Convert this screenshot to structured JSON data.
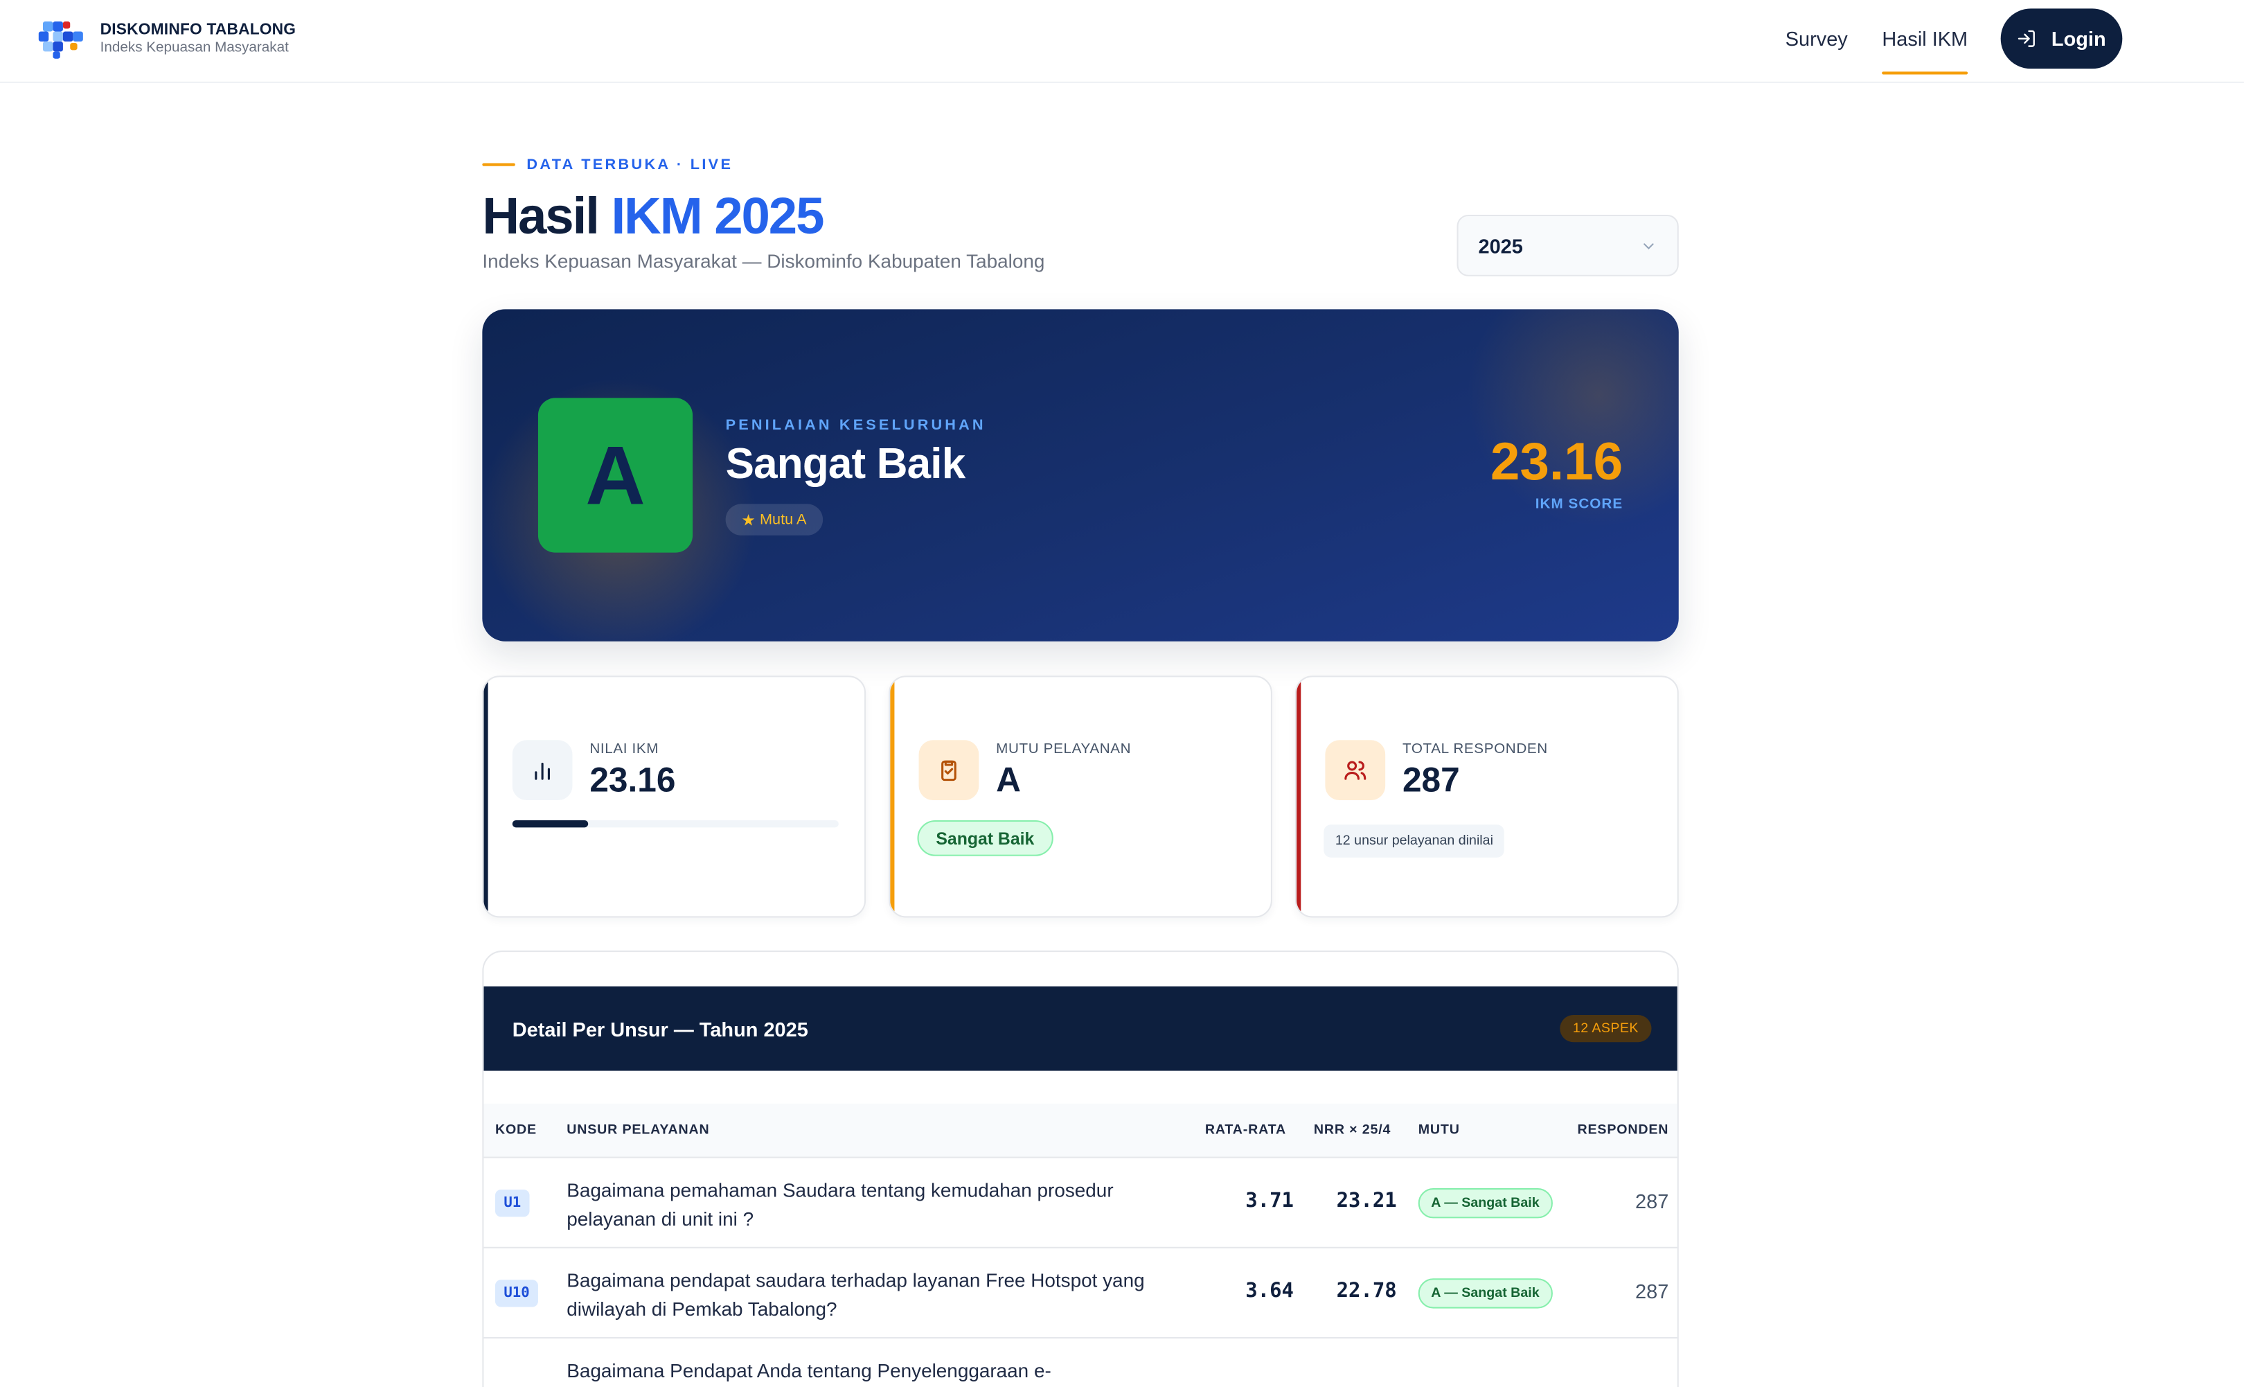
{
  "header": {
    "brand_name": "DISKOMINFO TABALONG",
    "brand_sub": "Indeks Kepuasan Masyarakat",
    "nav": [
      "Survey",
      "Hasil IKM"
    ],
    "login_label": "Login"
  },
  "page": {
    "eyebrow": "DATA TERBUKA · LIVE",
    "title_prefix": "Hasil",
    "title_accent": "IKM 2025",
    "subtitle": "Indeks Kepuasan Masyarakat — Diskominfo Kabupaten Tabalong",
    "year_selected": "2025"
  },
  "hero": {
    "grade": "A",
    "eyebrow": "PENILAIAN KESELURUHAN",
    "title": "Sangat Baik",
    "badge": "Mutu A",
    "score": "23.16",
    "score_label": "IKM SCORE"
  },
  "stats": {
    "nilai": {
      "label": "NILAI IKM",
      "value": "23.16",
      "progress_fraction": 0.2316
    },
    "mutu": {
      "label": "MUTU PELAYANAN",
      "value": "A",
      "pill": "Sangat Baik"
    },
    "responden": {
      "label": "TOTAL RESPONDEN",
      "value": "287",
      "note": "12 unsur pelayanan dinilai"
    }
  },
  "table": {
    "title": "Detail Per Unsur — Tahun 2025",
    "badge": "12 ASPEK",
    "columns": [
      "KODE",
      "UNSUR PELAYANAN",
      "RATA-RATA",
      "NRR × 25/4",
      "MUTU",
      "RESPONDEN"
    ],
    "rows": [
      {
        "code": "U1",
        "question": "Bagaimana pemahaman Saudara tentang kemudahan prosedur pelayanan di unit ini ?",
        "avg": "3.71",
        "nrr": "23.21",
        "mutu": "A — Sangat Baik",
        "resp": "287"
      },
      {
        "code": "U10",
        "question": "Bagaimana pendapat saudara terhadap layanan Free Hotspot yang diwilayah di Pemkab Tabalong?",
        "avg": "3.64",
        "nrr": "22.78",
        "mutu": "A — Sangat Baik",
        "resp": "287"
      },
      {
        "code": "",
        "question": "Bagaimana Pendapat Anda tentang Penyelenggaraan e-",
        "avg": "",
        "nrr": "",
        "mutu": "",
        "resp": ""
      }
    ]
  },
  "colors": {
    "navy": "#0d1f3e",
    "accent_blue": "#2563eb",
    "accent_orange": "#f59e0b",
    "grade_green": "#16a34a",
    "danger_red": "#b91c1c"
  }
}
